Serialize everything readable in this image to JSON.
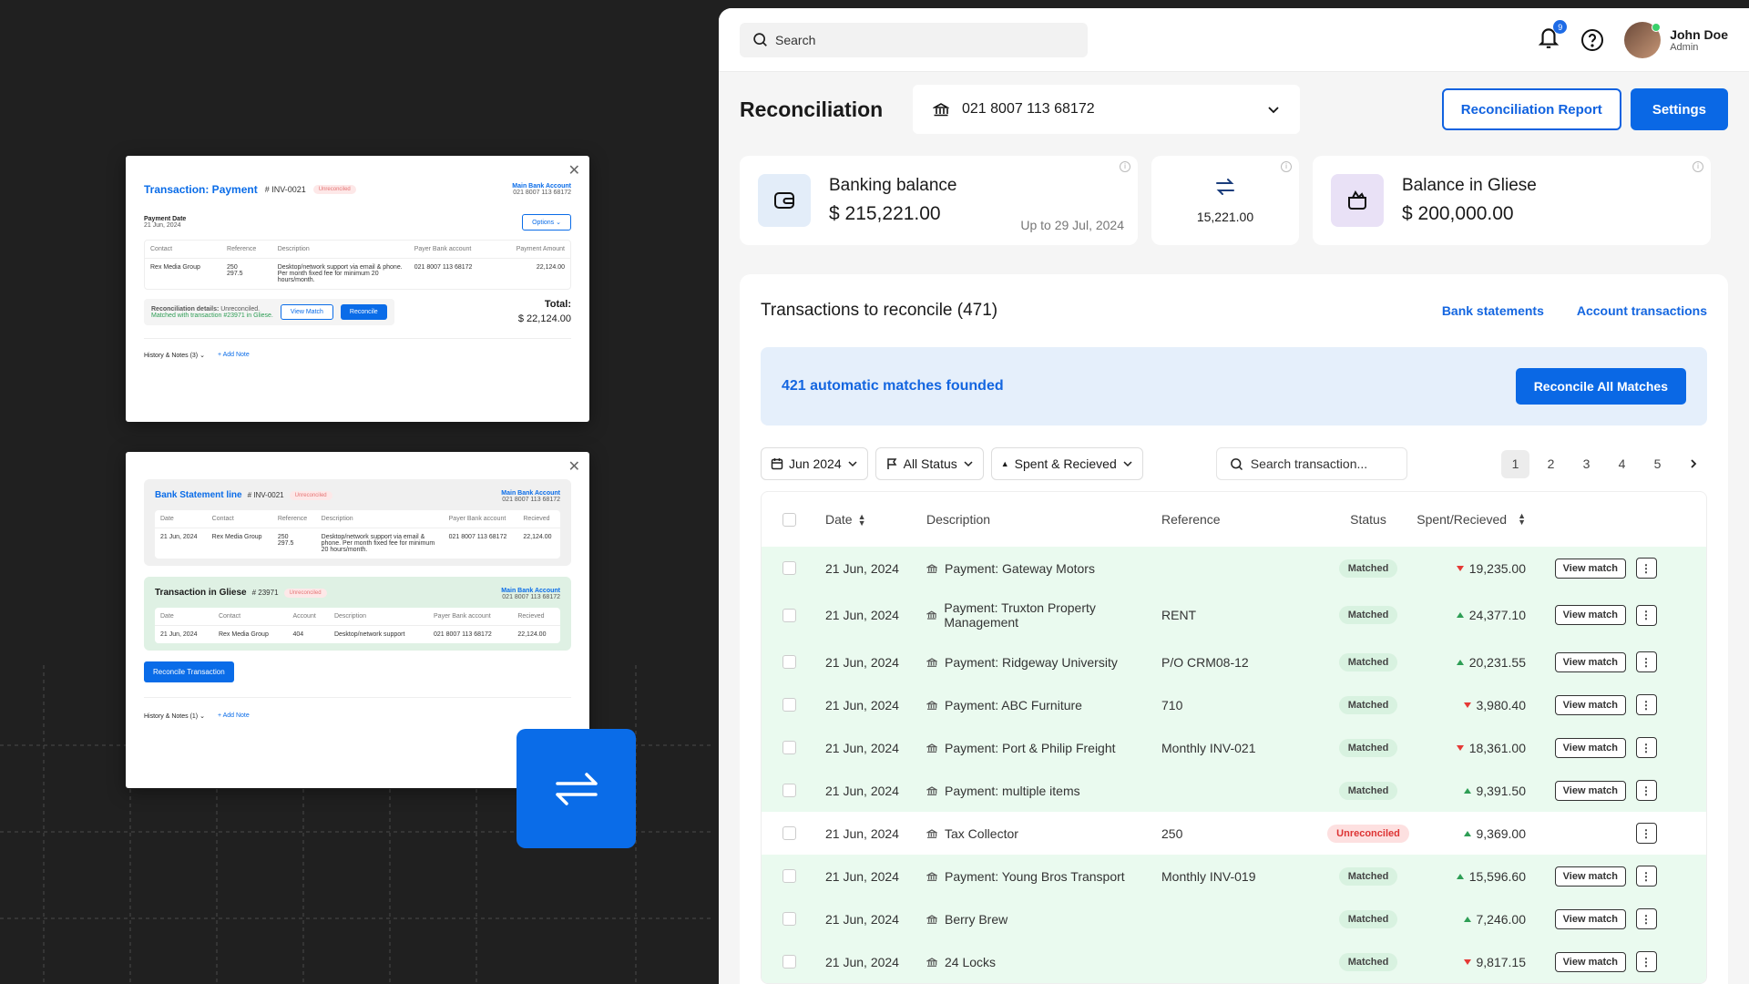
{
  "search": {
    "placeholder": "Search"
  },
  "notifications": {
    "count": "9"
  },
  "user": {
    "name": "John Doe",
    "role": "Admin"
  },
  "header": {
    "title": "Reconciliation",
    "account": "021 8007 113 68172",
    "report_button": "Reconciliation Report",
    "settings_button": "Settings"
  },
  "stats": {
    "banking_label": "Banking balance",
    "banking_value": "$ 215,221.00",
    "banking_date": "Up to 29 Jul, 2024",
    "diff_value": "15,221.00",
    "gliese_label": "Balance in Gliese",
    "gliese_value": "$ 200,000.00"
  },
  "panel": {
    "title": "Transactions to reconcile (471)",
    "link_bank": "Bank statements",
    "link_account": "Account transactions",
    "banner_text": "421 automatic matches founded",
    "reconcile_all": "Reconcile All Matches"
  },
  "filters": {
    "date": "Jun 2024",
    "status": "All Status",
    "type": "Spent & Recieved",
    "search_placeholder": "Search transaction..."
  },
  "pagination": [
    "1",
    "2",
    "3",
    "4",
    "5"
  ],
  "table": {
    "headers": {
      "date": "Date",
      "description": "Description",
      "reference": "Reference",
      "status": "Status",
      "amount": "Spent/Recieved"
    },
    "view_label": "View match",
    "rows": [
      {
        "date": "21 Jun, 2024",
        "description": "Payment: Gateway Motors",
        "reference": "",
        "status": "Matched",
        "dir": "down",
        "amount": "19,235.00"
      },
      {
        "date": "21 Jun, 2024",
        "description": "Payment: Truxton Property Management",
        "reference": "RENT",
        "status": "Matched",
        "dir": "up",
        "amount": "24,377.10"
      },
      {
        "date": "21 Jun, 2024",
        "description": "Payment: Ridgeway University",
        "reference": "P/O CRM08-12",
        "status": "Matched",
        "dir": "up",
        "amount": "20,231.55"
      },
      {
        "date": "21 Jun, 2024",
        "description": "Payment: ABC Furniture",
        "reference": "710",
        "status": "Matched",
        "dir": "down",
        "amount": "3,980.40"
      },
      {
        "date": "21 Jun, 2024",
        "description": "Payment: Port & Philip Freight",
        "reference": "Monthly INV-021",
        "status": "Matched",
        "dir": "down",
        "amount": "18,361.00"
      },
      {
        "date": "21 Jun, 2024",
        "description": "Payment: multiple items",
        "reference": "",
        "status": "Matched",
        "dir": "up",
        "amount": "9,391.50"
      },
      {
        "date": "21 Jun, 2024",
        "description": "Tax Collector",
        "reference": "250",
        "status": "Unreconciled",
        "dir": "up",
        "amount": "9,369.00"
      },
      {
        "date": "21 Jun, 2024",
        "description": "Payment: Young Bros Transport",
        "reference": "Monthly INV-019",
        "status": "Matched",
        "dir": "up",
        "amount": "15,596.60"
      },
      {
        "date": "21 Jun, 2024",
        "description": "Berry Brew",
        "reference": "",
        "status": "Matched",
        "dir": "up",
        "amount": "7,246.00"
      },
      {
        "date": "21 Jun, 2024",
        "description": "24 Locks",
        "reference": "",
        "status": "Matched",
        "dir": "down",
        "amount": "9,817.15"
      }
    ]
  },
  "card1": {
    "title": "Transaction: Payment",
    "inv": "# INV-0021",
    "badge": "Unreconciled",
    "bank_name": "Main Bank Account",
    "bank_num": "021 8007 113 68172",
    "options": "Options",
    "pay_date_label": "Payment Date",
    "pay_date": "21 Jun, 2024",
    "headers": [
      "Contact",
      "Reference",
      "Description",
      "Payer Bank account",
      "Payment Amount"
    ],
    "row": [
      "Rex Media Group",
      "250\n297.5",
      "Desktop/network support via email & phone. Per month fixed fee for minimum 20 hours/month.",
      "021 8007 113 68172",
      "22,124.00"
    ],
    "details_label": "Reconciliation details:",
    "details_status": "Unreconciled.",
    "matched_text": "Matched with transaction #23971 in Gliese.",
    "view_match": "View Match",
    "reconcile": "Reconcile",
    "total_label": "Total:",
    "total_value": "$ 22,124.00",
    "history": "History & Notes (3)",
    "add_note": "+ Add Note"
  },
  "card2": {
    "title": "Bank Statement line",
    "inv": "# INV-0021",
    "badge": "Unreconciled",
    "bank_name": "Main Bank Account",
    "bank_num": "021 8007 113 68172",
    "headers": [
      "Date",
      "Contact",
      "Reference",
      "Description",
      "Payer Bank account",
      "Recieved"
    ],
    "row": [
      "21 Jun, 2024",
      "Rex Media Group",
      "250\n297.5",
      "Desktop/network support via email & phone. Per month fixed fee for minimum 20 hours/month.",
      "021 8007 113 68172",
      "22,124.00"
    ],
    "g_title": "Transaction in Gliese",
    "g_inv": "# 23971",
    "g_badge": "Unreconciled",
    "g_headers": [
      "Date",
      "Contact",
      "Account",
      "Description",
      "Payer Bank account",
      "Recieved"
    ],
    "g_row": [
      "21 Jun, 2024",
      "Rex Media Group",
      "404",
      "Desktop/network support",
      "021 8007 113 68172",
      "22,124.00"
    ],
    "reconcile_btn": "Reconcile Transaction",
    "history": "History & Notes (1)",
    "add_note": "+ Add Note"
  },
  "colors": {
    "accent": "#0a68e5",
    "matched_row": "#eafaef",
    "dark_bg": "#202020"
  }
}
